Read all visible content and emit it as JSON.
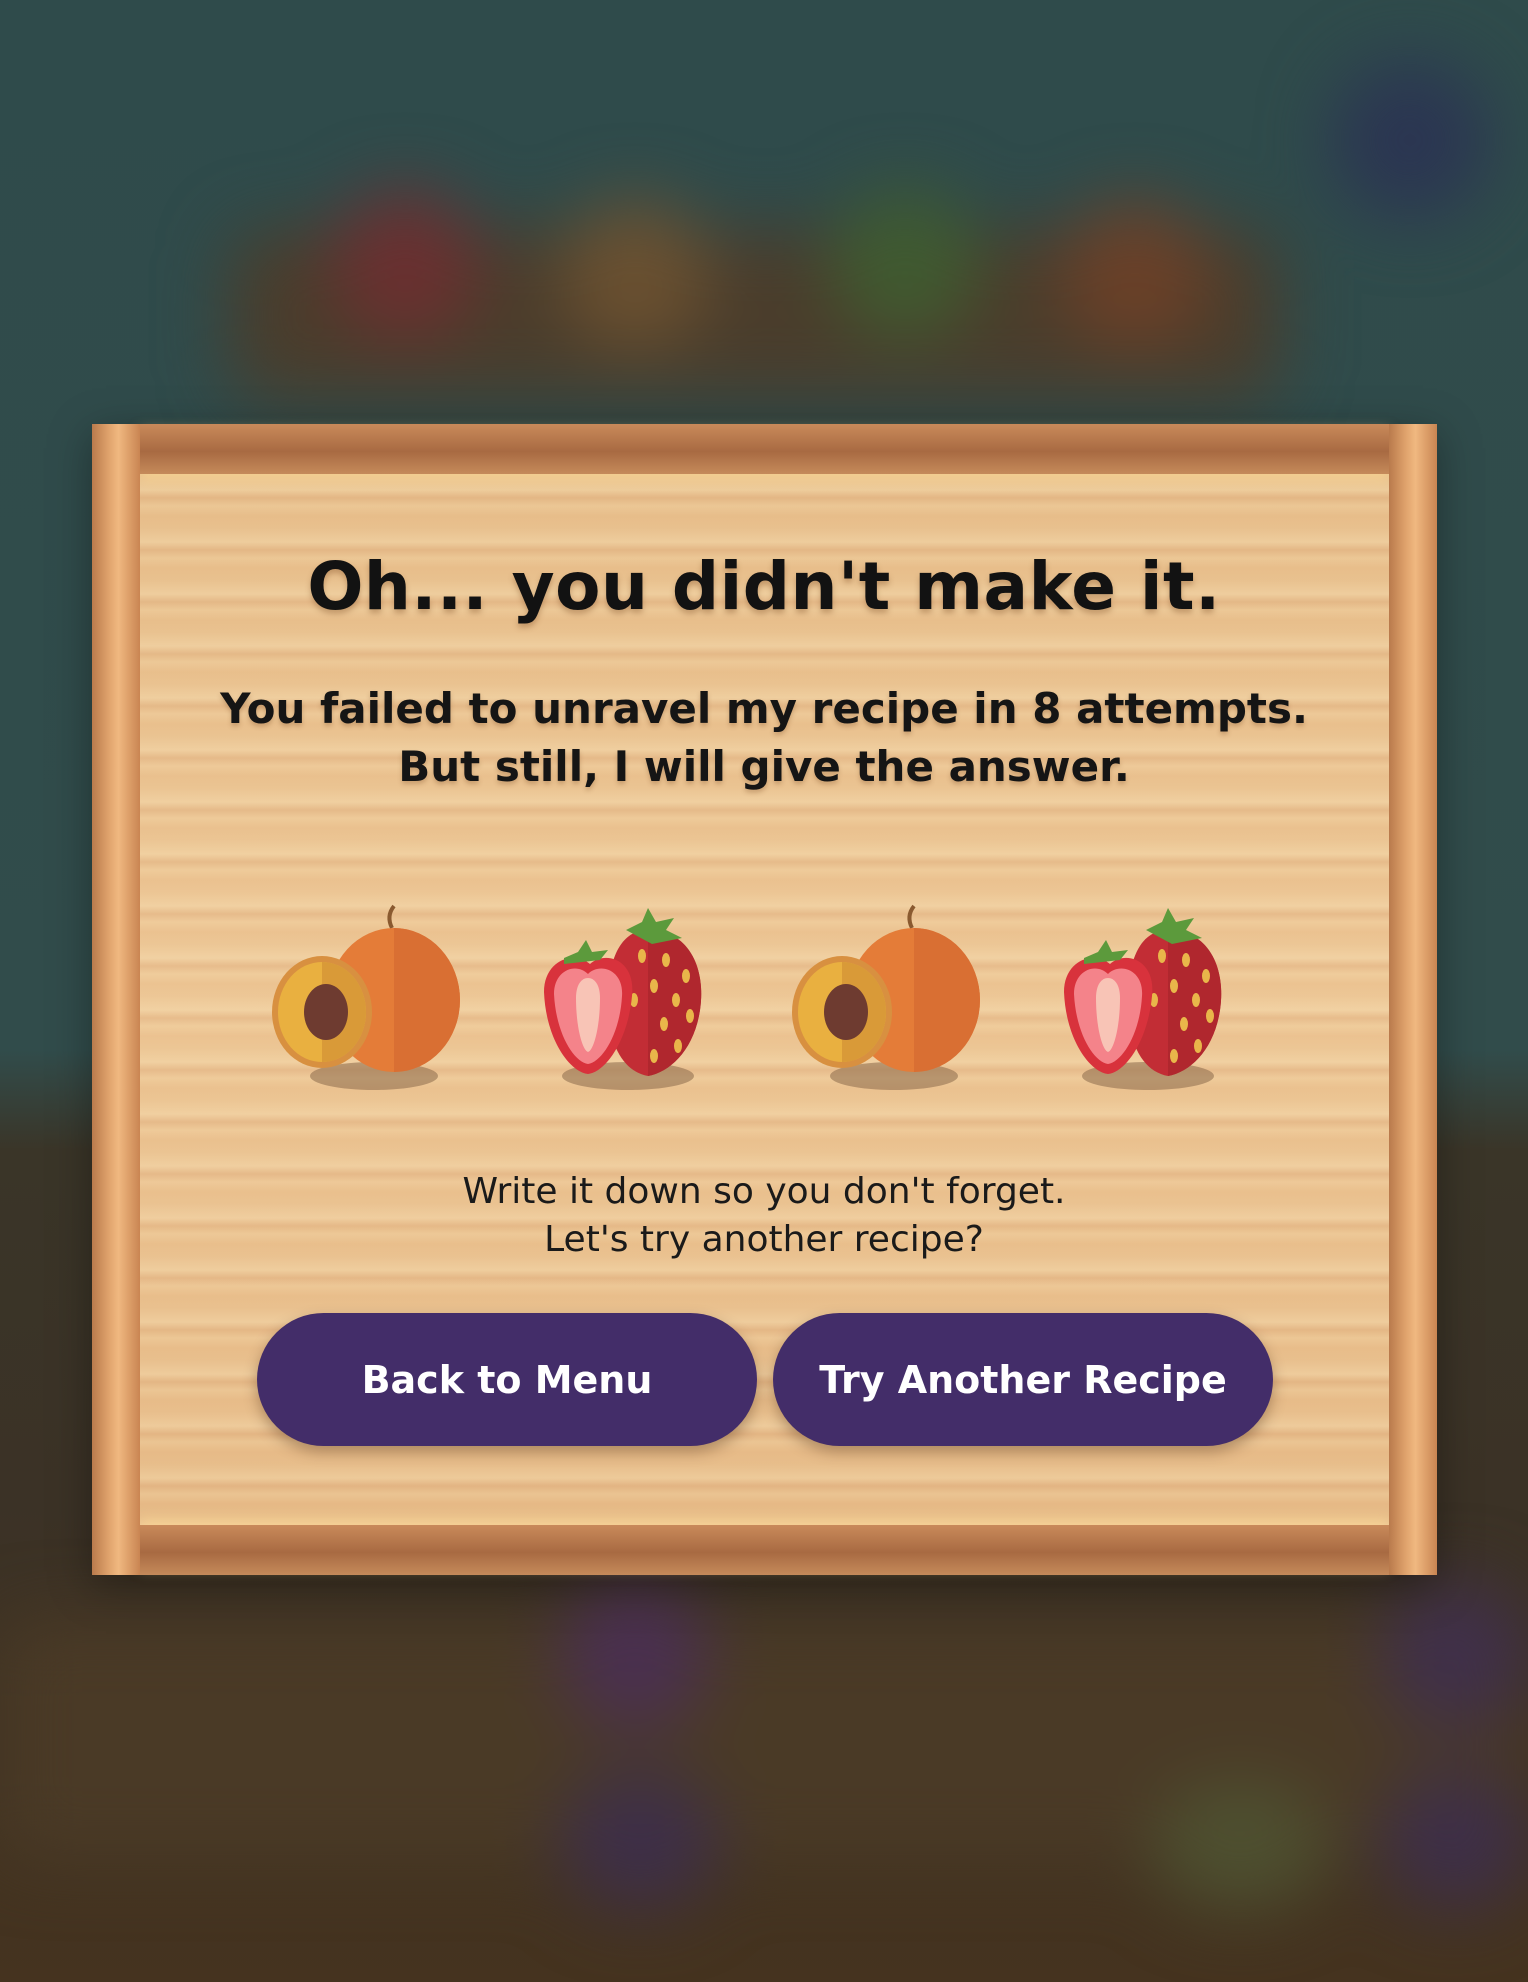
{
  "dialog": {
    "title": "Oh... you didn't make it.",
    "message_line1": "You failed to unravel my recipe in 8 attempts.",
    "message_line2": "But still, I will give the answer.",
    "note_line1": "Write it down so you don't forget.",
    "note_line2": "Let's try another recipe?"
  },
  "answer": {
    "fruits": [
      "apricot-icon",
      "strawberry-icon",
      "apricot-icon",
      "strawberry-icon"
    ]
  },
  "buttons": {
    "back_to_menu": "Back to Menu",
    "try_another": "Try Another Recipe"
  },
  "colors": {
    "button_bg": "#432d69",
    "board_wood": "#edc796",
    "backdrop_top": "#2f4b4b"
  }
}
